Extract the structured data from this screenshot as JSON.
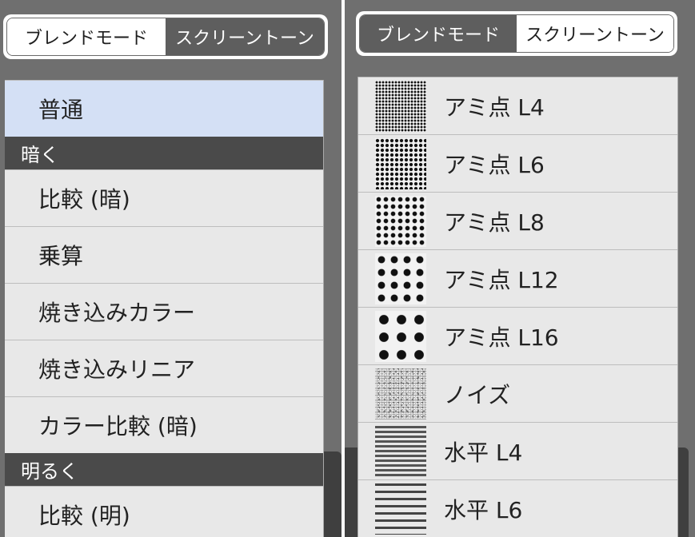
{
  "left_panel": {
    "segmented": {
      "blend_mode": "ブレンドモード",
      "screen_tone": "スクリーントーン",
      "selected": "screen_tone"
    },
    "items": [
      {
        "label": "普通",
        "selected": true
      },
      {
        "section": "暗く"
      },
      {
        "label": "比較 (暗)"
      },
      {
        "label": "乗算"
      },
      {
        "label": "焼き込みカラー"
      },
      {
        "label": "焼き込みリニア"
      },
      {
        "label": "カラー比較 (暗)"
      },
      {
        "section": "明るく"
      },
      {
        "label": "比較 (明)"
      }
    ]
  },
  "right_panel": {
    "segmented": {
      "blend_mode": "ブレンドモード",
      "screen_tone": "スクリーントーン",
      "selected": "blend_mode"
    },
    "items": [
      {
        "label": "アミ点 L4",
        "pattern": "dots-4"
      },
      {
        "label": "アミ点 L6",
        "pattern": "dots-6"
      },
      {
        "label": "アミ点 L8",
        "pattern": "dots-8"
      },
      {
        "label": "アミ点 L12",
        "pattern": "dots-12"
      },
      {
        "label": "アミ点 L16",
        "pattern": "dots-16"
      },
      {
        "label": "ノイズ",
        "pattern": "noise"
      },
      {
        "label": "水平 L4",
        "pattern": "hlines-4"
      },
      {
        "label": "水平 L6",
        "pattern": "hlines-6"
      }
    ]
  },
  "colors": {
    "selected_row": "#d4e0f5",
    "section_header": "#4a4a4a",
    "segment_active": "#5e5e5e"
  }
}
